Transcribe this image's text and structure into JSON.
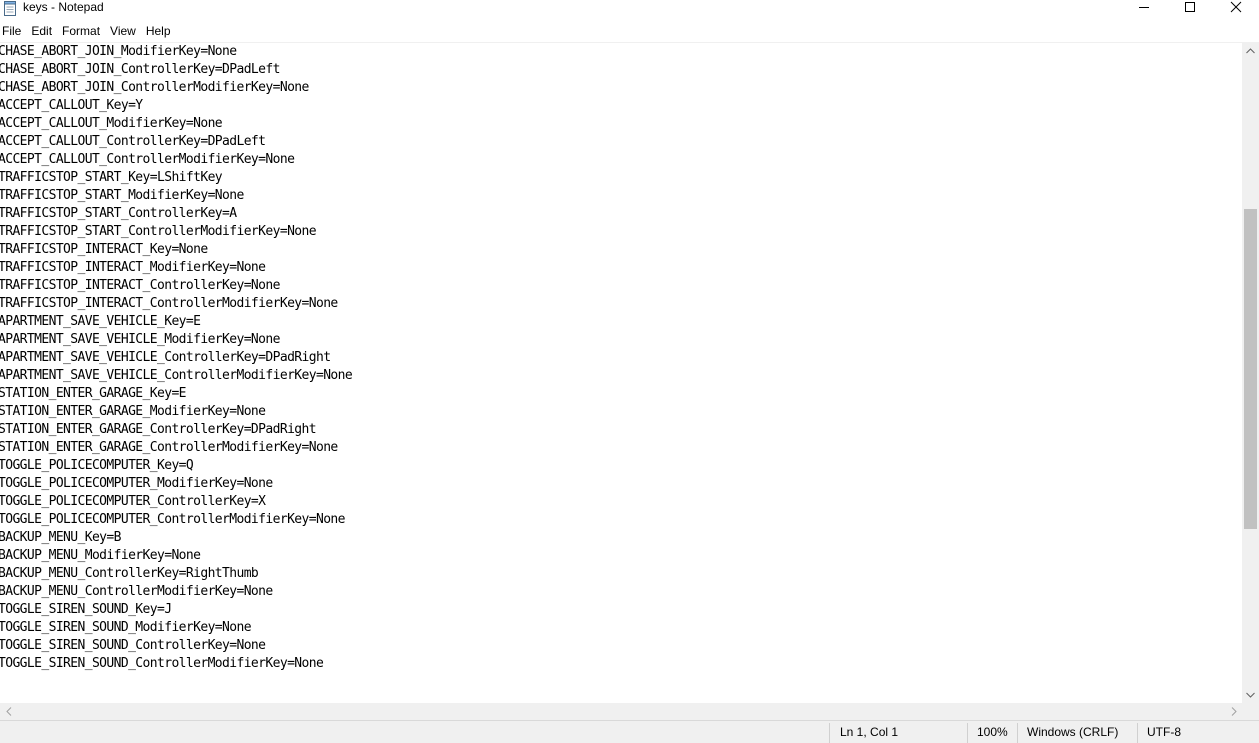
{
  "window": {
    "title": "keys - Notepad"
  },
  "menu": [
    {
      "label": "File"
    },
    {
      "label": "Edit"
    },
    {
      "label": "Format"
    },
    {
      "label": "View"
    },
    {
      "label": "Help"
    }
  ],
  "editor": {
    "lines": [
      "CHASE_ABORT_JOIN_ModifierKey=None",
      "CHASE_ABORT_JOIN_ControllerKey=DPadLeft",
      "CHASE_ABORT_JOIN_ControllerModifierKey=None",
      "ACCEPT_CALLOUT_Key=Y",
      "ACCEPT_CALLOUT_ModifierKey=None",
      "ACCEPT_CALLOUT_ControllerKey=DPadLeft",
      "ACCEPT_CALLOUT_ControllerModifierKey=None",
      "TRAFFICSTOP_START_Key=LShiftKey",
      "TRAFFICSTOP_START_ModifierKey=None",
      "TRAFFICSTOP_START_ControllerKey=A",
      "TRAFFICSTOP_START_ControllerModifierKey=None",
      "TRAFFICSTOP_INTERACT_Key=None",
      "TRAFFICSTOP_INTERACT_ModifierKey=None",
      "TRAFFICSTOP_INTERACT_ControllerKey=None",
      "TRAFFICSTOP_INTERACT_ControllerModifierKey=None",
      "APARTMENT_SAVE_VEHICLE_Key=E",
      "APARTMENT_SAVE_VEHICLE_ModifierKey=None",
      "APARTMENT_SAVE_VEHICLE_ControllerKey=DPadRight",
      "APARTMENT_SAVE_VEHICLE_ControllerModifierKey=None",
      "STATION_ENTER_GARAGE_Key=E",
      "STATION_ENTER_GARAGE_ModifierKey=None",
      "STATION_ENTER_GARAGE_ControllerKey=DPadRight",
      "STATION_ENTER_GARAGE_ControllerModifierKey=None",
      "TOGGLE_POLICECOMPUTER_Key=Q",
      "TOGGLE_POLICECOMPUTER_ModifierKey=None",
      "TOGGLE_POLICECOMPUTER_ControllerKey=X",
      "TOGGLE_POLICECOMPUTER_ControllerModifierKey=None",
      "BACKUP_MENU_Key=B",
      "BACKUP_MENU_ModifierKey=None",
      "BACKUP_MENU_ControllerKey=RightThumb",
      "BACKUP_MENU_ControllerModifierKey=None",
      "TOGGLE_SIREN_SOUND_Key=J",
      "TOGGLE_SIREN_SOUND_ModifierKey=None",
      "TOGGLE_SIREN_SOUND_ControllerKey=None",
      "TOGGLE_SIREN_SOUND_ControllerModifierKey=None"
    ]
  },
  "status": {
    "position": "Ln 1, Col 1",
    "zoom": "100%",
    "line_ending": "Windows (CRLF)",
    "encoding": "UTF-8"
  },
  "scrollbar": {
    "vertical_position": 0.49,
    "vertical_visible_fraction": 0.51
  }
}
